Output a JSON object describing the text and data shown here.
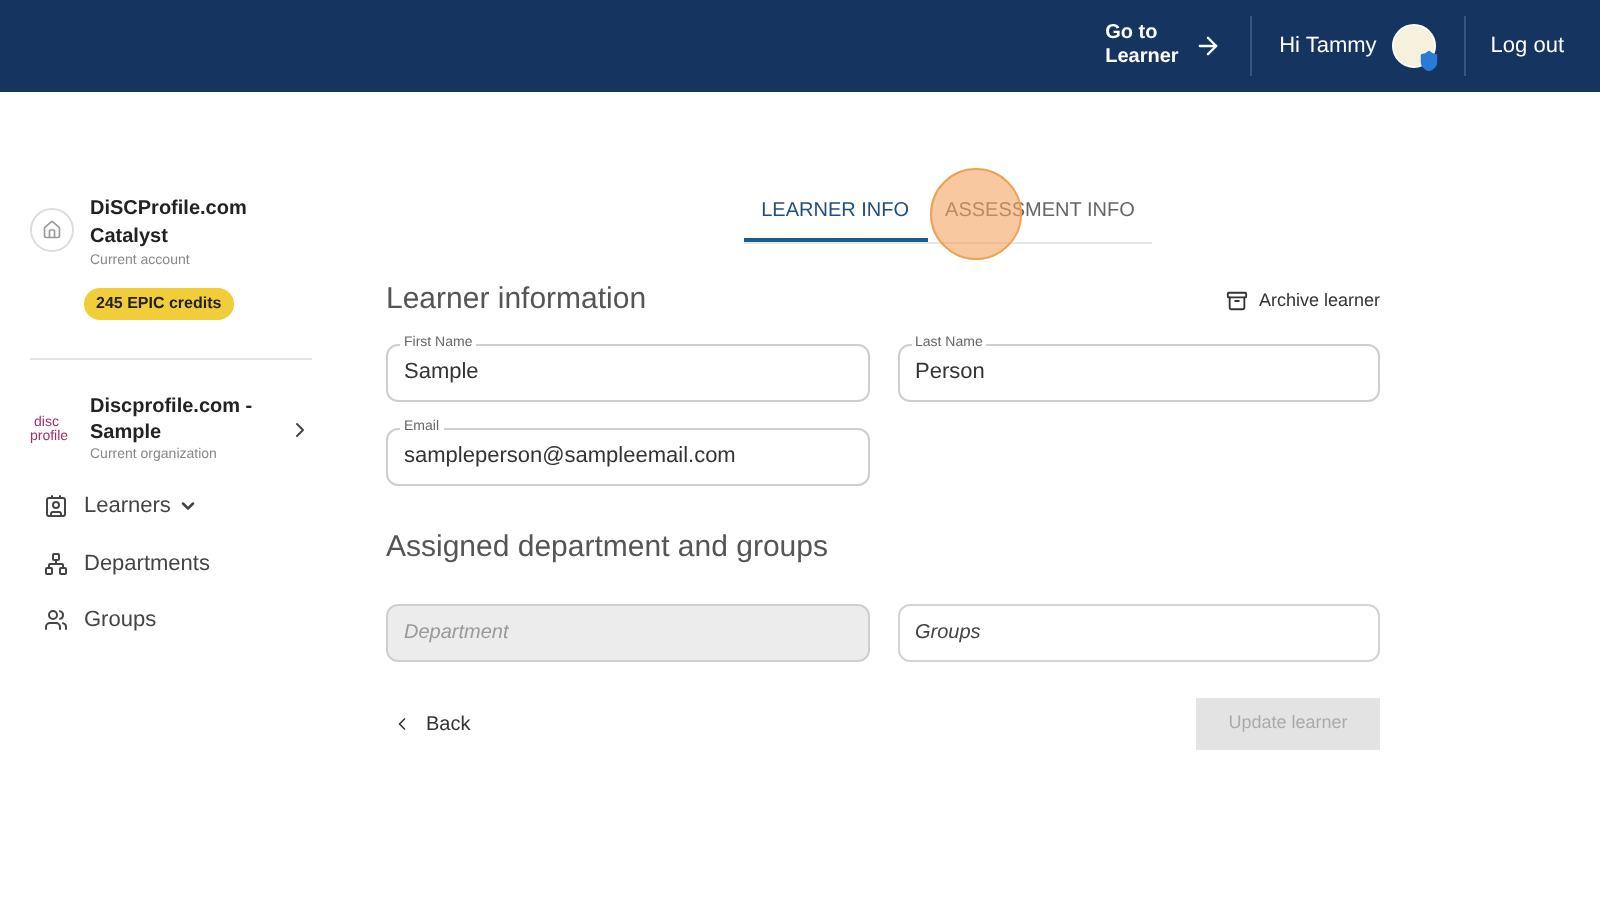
{
  "header": {
    "go_to_learner": "Go to Learner",
    "greeting": "Hi Tammy",
    "logout": "Log out"
  },
  "sidebar": {
    "account": {
      "name": "DiSCProfile.com Catalyst",
      "subtitle": "Current account",
      "credits": "245 EPIC credits"
    },
    "organization": {
      "logo": [
        "disc",
        "profile"
      ],
      "name": "Discprofile.com - Sample",
      "subtitle": "Current organization"
    },
    "nav": [
      {
        "label": "Learners",
        "kind": "menu"
      },
      {
        "label": "Departments",
        "kind": "link"
      },
      {
        "label": "Groups",
        "kind": "link"
      }
    ]
  },
  "tabs": [
    {
      "label": "LEARNER INFO",
      "selected": true
    },
    {
      "label": "ASSESSMENT INFO",
      "selected": false
    }
  ],
  "learner_section": {
    "title": "Learner information",
    "archive": "Archive learner",
    "fields": [
      {
        "label": "First Name",
        "value": "Sample"
      },
      {
        "label": "Last Name",
        "value": "Person"
      },
      {
        "label": "Email",
        "value": "sampleperson@sampleemail.com"
      }
    ]
  },
  "assignment_section": {
    "title": "Assigned department and groups",
    "fields": [
      {
        "placeholder": "Department",
        "disabled": true
      },
      {
        "placeholder": "Groups",
        "disabled": false
      }
    ]
  },
  "back": "Back",
  "update_button": {
    "label": "Update learner",
    "disabled": true
  }
}
